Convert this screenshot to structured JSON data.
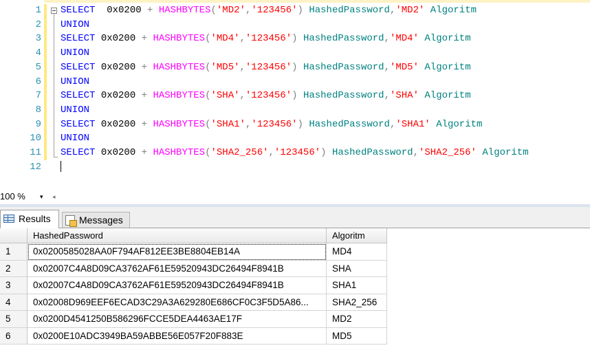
{
  "editor": {
    "lines": [
      {
        "n": "1",
        "tokens": [
          [
            "kw",
            "SELECT"
          ],
          [
            "",
            "  0x0200 "
          ],
          [
            "op",
            "+"
          ],
          [
            "",
            " "
          ],
          [
            "fn",
            "HASHBYTES"
          ],
          [
            "op",
            "("
          ],
          [
            "st",
            "'MD2'"
          ],
          [
            "op",
            ","
          ],
          [
            "st",
            "'123456'"
          ],
          [
            "op",
            ")"
          ],
          [
            "",
            " "
          ],
          [
            "al",
            "HashedPassword"
          ],
          [
            "op",
            ","
          ],
          [
            "st",
            "'MD2'"
          ],
          [
            "",
            " "
          ],
          [
            "al",
            "Algoritm"
          ]
        ]
      },
      {
        "n": "2",
        "tokens": [
          [
            "kw",
            "UNION"
          ]
        ]
      },
      {
        "n": "3",
        "tokens": [
          [
            "kw",
            "SELECT"
          ],
          [
            "",
            " 0x0200 "
          ],
          [
            "op",
            "+"
          ],
          [
            "",
            " "
          ],
          [
            "fn",
            "HASHBYTES"
          ],
          [
            "op",
            "("
          ],
          [
            "st",
            "'MD4'"
          ],
          [
            "op",
            ","
          ],
          [
            "st",
            "'123456'"
          ],
          [
            "op",
            ")"
          ],
          [
            "",
            " "
          ],
          [
            "al",
            "HashedPassword"
          ],
          [
            "op",
            ","
          ],
          [
            "st",
            "'MD4'"
          ],
          [
            "",
            " "
          ],
          [
            "al",
            "Algoritm"
          ]
        ]
      },
      {
        "n": "4",
        "tokens": [
          [
            "kw",
            "UNION"
          ]
        ]
      },
      {
        "n": "5",
        "tokens": [
          [
            "kw",
            "SELECT"
          ],
          [
            "",
            " 0x0200 "
          ],
          [
            "op",
            "+"
          ],
          [
            "",
            " "
          ],
          [
            "fn",
            "HASHBYTES"
          ],
          [
            "op",
            "("
          ],
          [
            "st",
            "'MD5'"
          ],
          [
            "op",
            ","
          ],
          [
            "st",
            "'123456'"
          ],
          [
            "op",
            ")"
          ],
          [
            "",
            " "
          ],
          [
            "al",
            "HashedPassword"
          ],
          [
            "op",
            ","
          ],
          [
            "st",
            "'MD5'"
          ],
          [
            "",
            " "
          ],
          [
            "al",
            "Algoritm"
          ]
        ]
      },
      {
        "n": "6",
        "tokens": [
          [
            "kw",
            "UNION"
          ]
        ]
      },
      {
        "n": "7",
        "tokens": [
          [
            "kw",
            "SELECT"
          ],
          [
            "",
            " 0x0200 "
          ],
          [
            "op",
            "+"
          ],
          [
            "",
            " "
          ],
          [
            "fn",
            "HASHBYTES"
          ],
          [
            "op",
            "("
          ],
          [
            "st",
            "'SHA'"
          ],
          [
            "op",
            ","
          ],
          [
            "st",
            "'123456'"
          ],
          [
            "op",
            ")"
          ],
          [
            "",
            " "
          ],
          [
            "al",
            "HashedPassword"
          ],
          [
            "op",
            ","
          ],
          [
            "st",
            "'SHA'"
          ],
          [
            "",
            " "
          ],
          [
            "al",
            "Algoritm"
          ]
        ]
      },
      {
        "n": "8",
        "tokens": [
          [
            "kw",
            "UNION"
          ]
        ]
      },
      {
        "n": "9",
        "tokens": [
          [
            "kw",
            "SELECT"
          ],
          [
            "",
            " 0x0200 "
          ],
          [
            "op",
            "+"
          ],
          [
            "",
            " "
          ],
          [
            "fn",
            "HASHBYTES"
          ],
          [
            "op",
            "("
          ],
          [
            "st",
            "'SHA1'"
          ],
          [
            "op",
            ","
          ],
          [
            "st",
            "'123456'"
          ],
          [
            "op",
            ")"
          ],
          [
            "",
            " "
          ],
          [
            "al",
            "HashedPassword"
          ],
          [
            "op",
            ","
          ],
          [
            "st",
            "'SHA1'"
          ],
          [
            "",
            " "
          ],
          [
            "al",
            "Algoritm"
          ]
        ]
      },
      {
        "n": "10",
        "tokens": [
          [
            "kw",
            "UNION"
          ]
        ]
      },
      {
        "n": "11",
        "tokens": [
          [
            "kw",
            "SELECT"
          ],
          [
            "",
            " 0x0200 "
          ],
          [
            "op",
            "+"
          ],
          [
            "",
            " "
          ],
          [
            "fn",
            "HASHBYTES"
          ],
          [
            "op",
            "("
          ],
          [
            "st",
            "'SHA2_256'"
          ],
          [
            "op",
            ","
          ],
          [
            "st",
            "'123456'"
          ],
          [
            "op",
            ")"
          ],
          [
            "",
            " "
          ],
          [
            "al",
            "HashedPassword"
          ],
          [
            "op",
            ","
          ],
          [
            "st",
            "'SHA2_256'"
          ],
          [
            "",
            " "
          ],
          [
            "al",
            "Algoritm"
          ]
        ]
      },
      {
        "n": "12",
        "tokens": []
      }
    ]
  },
  "zoom": {
    "value": "100 %",
    "arrow": "▾",
    "scroll_left": "◂"
  },
  "tabs": {
    "results": "Results",
    "messages": "Messages"
  },
  "grid": {
    "columns": [
      "HashedPassword",
      "Algoritm"
    ],
    "rows": [
      {
        "num": "1",
        "hash": "0x0200585028AA0F794AF812EE3BE8804EB14A",
        "alg": "MD4"
      },
      {
        "num": "2",
        "hash": "0x02007C4A8D09CA3762AF61E59520943DC26494F8941B",
        "alg": "SHA"
      },
      {
        "num": "3",
        "hash": "0x02007C4A8D09CA3762AF61E59520943DC26494F8941B",
        "alg": "SHA1"
      },
      {
        "num": "4",
        "hash": "0x02008D969EEF6ECAD3C29A3A629280E686CF0C3F5D5A86...",
        "alg": "SHA2_256"
      },
      {
        "num": "5",
        "hash": "0x0200D4541250B586296FCCE5DEA4463AE17F",
        "alg": "MD2"
      },
      {
        "num": "6",
        "hash": "0x0200E10ADC3949BA59ABBE56E057F20F883E",
        "alg": "MD5"
      }
    ]
  },
  "colors": {
    "keyword": "#0000ff",
    "function": "#ff00ff",
    "string": "#ff0000",
    "alias": "#008080",
    "line_number": "#2b91af"
  }
}
